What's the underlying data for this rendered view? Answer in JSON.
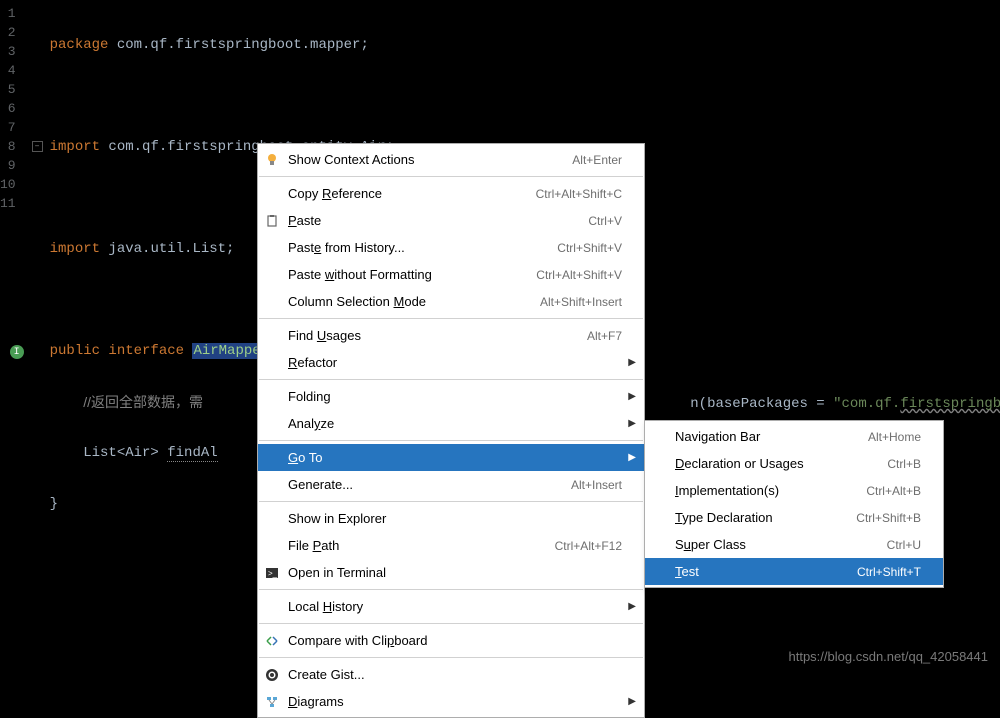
{
  "gutter": [
    "1",
    "2",
    "3",
    "4",
    "5",
    "6",
    "7",
    "8",
    "9",
    "10",
    "11"
  ],
  "code": {
    "l1_kw": "package",
    "l1_rest": " com.qf.firstspringboot.mapper;",
    "l3_kw": "import",
    "l3_rest": " com.qf.firstspringboot.entity.Air;",
    "l5_kw": "import",
    "l5_rest": " java.util.List;",
    "l7_kw1": "public ",
    "l7_kw2": "interface",
    "l7_sp": " ",
    "l7_cls": "AirMapper",
    "l7_br": " {",
    "l8_comment": "//返回全部数据，需",
    "l8_tail_a": "n(basePackages = ",
    "l8_tail_str": "\"com.qf.",
    "l8_tail_wavy": "firstspringboo",
    "l9_a": "List<Air> ",
    "l9_m": "findAl",
    "l10": "}"
  },
  "main_menu": [
    {
      "type": "item",
      "icon": "bulb",
      "label": "Show Context Actions",
      "shortcut": "Alt+Enter",
      "sub": false
    },
    {
      "type": "sep"
    },
    {
      "type": "item",
      "icon": "",
      "label": "Copy Reference",
      "u": 5,
      "shortcut": "Ctrl+Alt+Shift+C",
      "sub": false
    },
    {
      "type": "item",
      "icon": "paste",
      "label": "Paste",
      "u": 0,
      "shortcut": "Ctrl+V",
      "sub": false
    },
    {
      "type": "item",
      "icon": "",
      "label": "Paste from History...",
      "u": 4,
      "shortcut": "Ctrl+Shift+V",
      "sub": false
    },
    {
      "type": "item",
      "icon": "",
      "label": "Paste without Formatting",
      "u": 6,
      "shortcut": "Ctrl+Alt+Shift+V",
      "sub": false
    },
    {
      "type": "item",
      "icon": "",
      "label": "Column Selection Mode",
      "u": 17,
      "shortcut": "Alt+Shift+Insert",
      "sub": false
    },
    {
      "type": "sep"
    },
    {
      "type": "item",
      "icon": "",
      "label": "Find Usages",
      "u": 5,
      "shortcut": "Alt+F7",
      "sub": false
    },
    {
      "type": "item",
      "icon": "",
      "label": "Refactor",
      "u": 0,
      "shortcut": "",
      "sub": true
    },
    {
      "type": "sep"
    },
    {
      "type": "item",
      "icon": "",
      "label": "Folding",
      "shortcut": "",
      "sub": true
    },
    {
      "type": "item",
      "icon": "",
      "label": "Analyze",
      "u": 4,
      "shortcut": "",
      "sub": true
    },
    {
      "type": "sep"
    },
    {
      "type": "item",
      "icon": "",
      "label": "Go To",
      "u": 0,
      "shortcut": "",
      "sub": true,
      "hl": true
    },
    {
      "type": "item",
      "icon": "",
      "label": "Generate...",
      "shortcut": "Alt+Insert",
      "sub": false
    },
    {
      "type": "sep"
    },
    {
      "type": "item",
      "icon": "",
      "label": "Show in Explorer",
      "shortcut": "",
      "sub": false
    },
    {
      "type": "item",
      "icon": "",
      "label": "File Path",
      "u": 5,
      "shortcut": "Ctrl+Alt+F12",
      "sub": false
    },
    {
      "type": "item",
      "icon": "terminal",
      "label": "Open in Terminal",
      "shortcut": "",
      "sub": false
    },
    {
      "type": "sep"
    },
    {
      "type": "item",
      "icon": "",
      "label": "Local History",
      "u": 6,
      "shortcut": "",
      "sub": true
    },
    {
      "type": "sep"
    },
    {
      "type": "item",
      "icon": "compare",
      "label": "Compare with Clipboard",
      "u": 16,
      "shortcut": "",
      "sub": false
    },
    {
      "type": "sep"
    },
    {
      "type": "item",
      "icon": "github",
      "label": "Create Gist...",
      "shortcut": "",
      "sub": false
    },
    {
      "type": "item",
      "icon": "diagram",
      "label": "Diagrams",
      "u": 0,
      "shortcut": "",
      "sub": true
    }
  ],
  "sub_menu": [
    {
      "label": "Navigation Bar",
      "shortcut": "Alt+Home"
    },
    {
      "label": "Declaration or Usages",
      "u": 0,
      "shortcut": "Ctrl+B"
    },
    {
      "label": "Implementation(s)",
      "u": 0,
      "shortcut": "Ctrl+Alt+B"
    },
    {
      "label": "Type Declaration",
      "u": 0,
      "shortcut": "Ctrl+Shift+B"
    },
    {
      "label": "Super Class",
      "u": 1,
      "shortcut": "Ctrl+U"
    },
    {
      "label": "Test",
      "u": 0,
      "shortcut": "Ctrl+Shift+T",
      "hl": true
    }
  ],
  "watermark": "https://blog.csdn.net/qq_42058441"
}
